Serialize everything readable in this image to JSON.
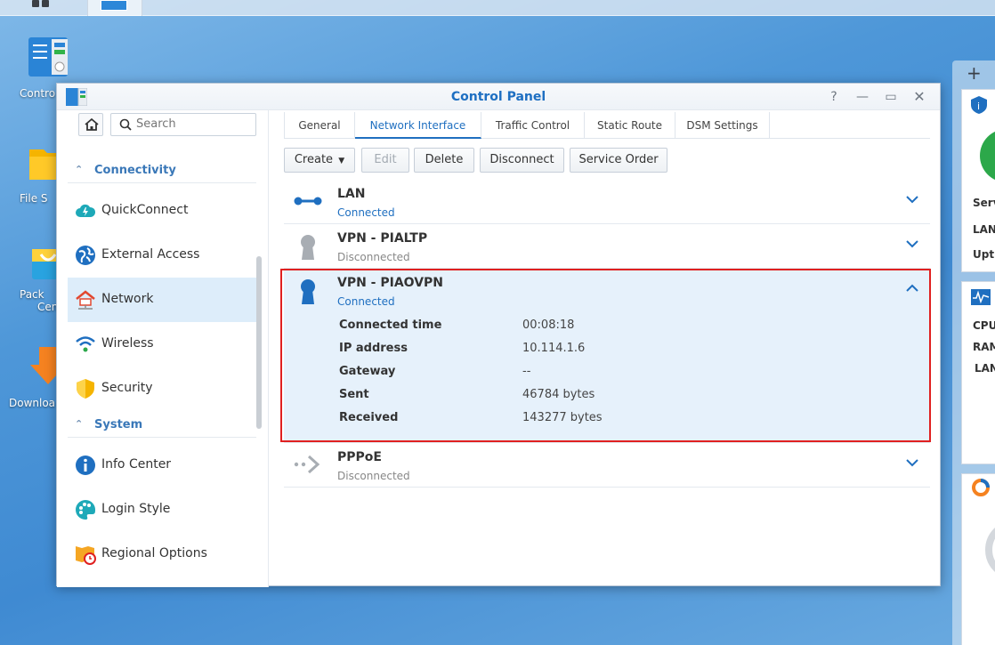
{
  "window": {
    "title": "Control Panel"
  },
  "desktop": {
    "icons": [
      {
        "label": "Contro"
      },
      {
        "label": "File S"
      },
      {
        "label": "Pack"
      },
      {
        "label": "Cen"
      },
      {
        "label": "Downloa"
      }
    ]
  },
  "sidebar": {
    "search_placeholder": "Search",
    "sections": [
      {
        "title": "Connectivity"
      },
      {
        "title": "System"
      }
    ],
    "items": [
      {
        "label": "QuickConnect"
      },
      {
        "label": "External Access"
      },
      {
        "label": "Network"
      },
      {
        "label": "Wireless"
      },
      {
        "label": "Security"
      },
      {
        "label": "Info Center"
      },
      {
        "label": "Login Style"
      },
      {
        "label": "Regional Options"
      }
    ]
  },
  "tabs": [
    {
      "label": "General"
    },
    {
      "label": "Network Interface"
    },
    {
      "label": "Traffic Control"
    },
    {
      "label": "Static Route"
    },
    {
      "label": "DSM Settings"
    }
  ],
  "toolbar": {
    "create": "Create",
    "edit": "Edit",
    "delete": "Delete",
    "disconnect": "Disconnect",
    "service_order": "Service Order"
  },
  "interfaces": [
    {
      "name": "LAN",
      "status": "Connected"
    },
    {
      "name": "VPN - PIALTP",
      "status": "Disconnected"
    },
    {
      "name": "VPN - PIAOVPN",
      "status": "Connected",
      "details": [
        {
          "key": "Connected time",
          "value": "00:08:18"
        },
        {
          "key": "IP address",
          "value": "10.114.1.6"
        },
        {
          "key": "Gateway",
          "value": "--"
        },
        {
          "key": "Sent",
          "value": "46784 bytes"
        },
        {
          "key": "Received",
          "value": "143277 bytes"
        }
      ]
    },
    {
      "name": "PPPoE",
      "status": "Disconnected"
    }
  ],
  "widgets": {
    "labels": [
      "Serv",
      "LAN",
      "Upti",
      "CPU",
      "RAM",
      "LAN"
    ]
  },
  "colors": {
    "accent": "#1f6fc0",
    "highlight": "#e02020"
  }
}
